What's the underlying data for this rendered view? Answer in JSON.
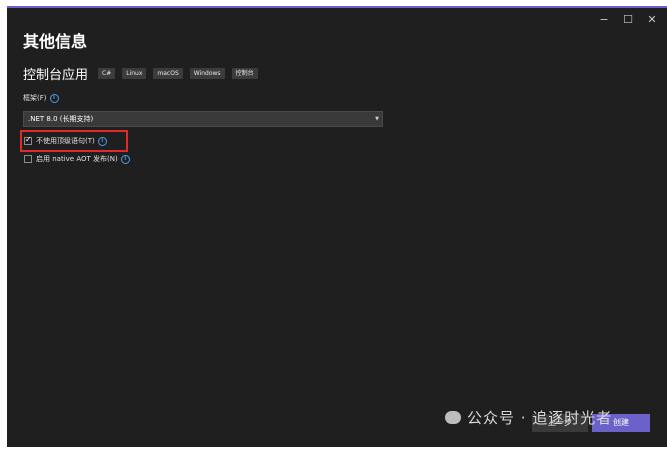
{
  "window": {
    "minimize_glyph": "−",
    "maximize_glyph": "☐",
    "close_glyph": "✕"
  },
  "page_title": "其他信息",
  "template": {
    "name": "控制台应用",
    "tags": [
      "C#",
      "Linux",
      "macOS",
      "Windows",
      "控制台"
    ]
  },
  "framework": {
    "label": "框架(F)",
    "info_glyph": "i",
    "selected": ".NET 8.0 (长期支持)",
    "chevron": "▼"
  },
  "options": [
    {
      "label": "不使用顶级语句(T)",
      "checked": true
    },
    {
      "label": "启用 native AOT 发布(N)",
      "checked": false
    }
  ],
  "buttons": {
    "prev": "上一步",
    "next": "创建"
  },
  "watermark": "公众号 · 追逐时光者",
  "colors": {
    "accent": "#6b62c9",
    "background": "#1f1f1f",
    "highlight_box": "#e12b2b",
    "info_icon": "#4d9dea"
  }
}
